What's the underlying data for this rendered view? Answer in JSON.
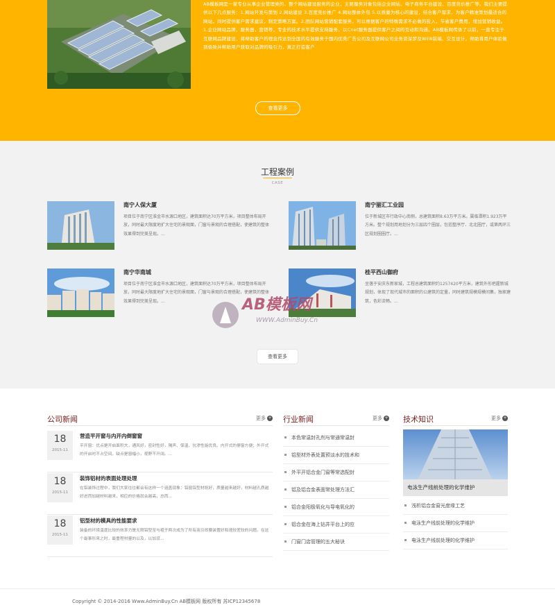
{
  "about": {
    "text": "AB模板网是一家专业从事企业管理类的、整个网站建设服务的企业，主要服务对象包括企业网站、电子商务平台建设、百度竞价推广等。我们主要提供以下几点服务：1.网站开发与策划 2.网站建设 3.百度竞价推广 4.网站整体外包 5.以质量为核心的建设，结合客户需求，为客户精准策划最适合的网站，同时提供客户需求建议，制定策略方案。2.团队网站营销配套服务，可以根据客户的特殊需求不必做的投入，节省客户费用，增加营销收益。1.企业网站品牌，服务器，营销等，专业的技术水平提供支持服务，以Cnet服务器提供客户之间的互动和沟通。AB模板网传承了以前，一直专注于互联网品牌建设，将帮助客户的理念传达到全国的有效服务于国内优秀广告公司及互联网公司业务资深梦及WEB前端、交互设计，帮助将用户体验做到极致并帮助用户获取对品牌的吸引力，真正打造客户",
    "more_label": "查看更多"
  },
  "cases": {
    "title": "工程案例",
    "subtitle": "CASE",
    "items": [
      {
        "title": "南宁人保大厦",
        "desc": "项目位于南宁区淮金市水源口地区，建筑面积达70万平方米，项目整体布局开放，同时最大限度地扩大住宅的景观面，门窗与景观的合理搭配，使建筑的整体效果得到完美呈现。..."
      },
      {
        "title": "南宁丽汇工业园",
        "desc": "位于新城区市行政中心南侧，总建筑面积8.63万平方米。属临潭积1.923万平方米。整个规划用地划分为三层四个圈层，包括整序厅、北北圈厅，或第两环三区规划圈圈厅。..."
      },
      {
        "title": "南宁华南城",
        "desc": "项目位于南宁区淮金市水源口地区，建筑面积达70万平方米，项目整体布局开放，同时最大限度地扩大住宅的景观面，门窗与景观的合理搭配，使建筑的整体效果得到完美呈现。..."
      },
      {
        "title": "桂平西山御府",
        "desc": "坐落于安庆东新家城，工程总建筑面积约1257420平方米，建筑外形把握新城规划，体现了现代城市的面积的公建筑的定量，同时建筑规模规模间集，独家建筑，色彩流畅。..."
      }
    ],
    "more_label": "查看更多"
  },
  "watermark": {
    "brand": "AB模板网",
    "url": "WWW.AdminBuy.Cn"
  },
  "news": {
    "company": {
      "title": "公司新闻",
      "more": "更多",
      "items": [
        {
          "day": "18",
          "month": "2015-11",
          "title": "营造平开窗与内开内倒窗窗",
          "desc": "平开窗：优点是开启面积大，通风好，密封性好，隔声、保温、抗渗性能优良。内开式的擦窗方便；外开式的开启时不占空间。缺点是窗幅小，视野不开阔。..."
        },
        {
          "day": "18",
          "month": "2015-11",
          "title": "装饰铝材的表面处理处理",
          "desc": "在铝装饰过程中，我们大家往往都会有这样一个涵盖现象：铝窗铝型材既好，质量越来越好，材料越孔质越好进而加越材料越来，相应的价格就会越高，总而..."
        },
        {
          "day": "18",
          "month": "2015-11",
          "title": "铝型材的模具的性能要求",
          "desc": "装备的环境温度比较的效率力是无限铝型至与粗于两次成为了所有商贝即要装置好和速较差较的问题。在这个最事形来之时，最重程材量的以及，以加设..."
        }
      ]
    },
    "industry": {
      "title": "行业新闻",
      "more": "更多",
      "items": [
        "本色常温封孔剂与常通常温封",
        "铝型材外表处置预淡水的技术和",
        "外平开铝合金门窗等常选配封",
        "铝及铝合金表面常处理方法汇",
        "铝合金阳极氧化与导电氧化的",
        "铝合金在海上钻井平台上的应",
        "门窗门店管理的五大秘诀"
      ]
    },
    "tech": {
      "title": "技术知识",
      "more": "更多",
      "feature_caption": "电泳生产线前处理的化学维护",
      "items": [
        "浅析铝合金窗光度缘工艺",
        "电泳生产线前处理的化学维护",
        "电泳生产线前处理的化学维护"
      ]
    }
  },
  "footer": {
    "copyright": "Copyright © 2014-2016 Www.AdminBuy.Cn AB模板网 版权所有   苏ICP12345678"
  }
}
